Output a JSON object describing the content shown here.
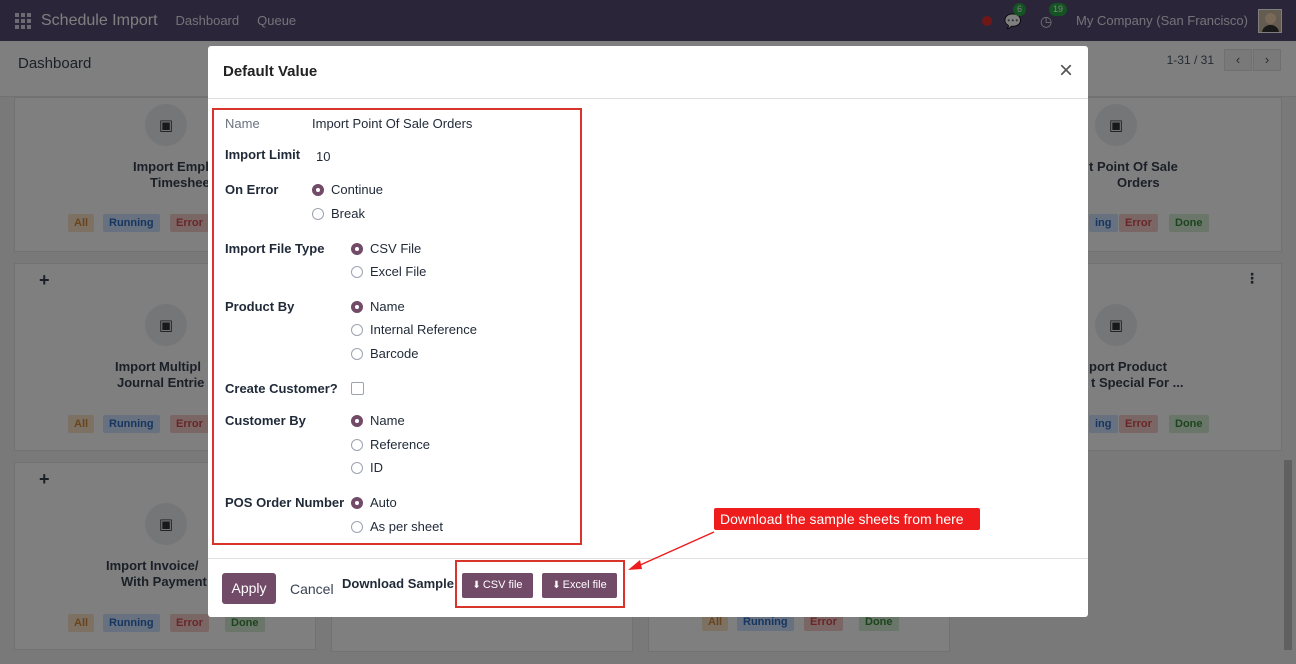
{
  "navbar": {
    "app_title": "Schedule Import",
    "menu": [
      "Dashboard",
      "Queue"
    ],
    "chat_count": "6",
    "activity_count": "19",
    "company": "My Company (San Francisco)"
  },
  "control_panel": {
    "breadcrumb": "Dashboard",
    "pager": "1-31 / 31",
    "prev": "‹",
    "next": "›"
  },
  "cards": {
    "c1": {
      "title": "Import Employee Timesheet",
      "title_visible_left": "Import Employe",
      "title_visible_left2": "Timesheet"
    },
    "c2": {
      "title_visible": "t Point Of Sale",
      "title_visible2": "Orders"
    },
    "c3": {
      "title_visible": "Import Multipl",
      "title_visible2": "Journal Entrie"
    },
    "c4": {
      "title_visible": "port Product",
      "title_visible2": "t Special For ..."
    },
    "c5": {
      "title_visible": "Import Invoice/",
      "title_visible2": "With Payment"
    },
    "plus": "+",
    "tags": {
      "all": "All",
      "running": "Running",
      "error": "Error",
      "done": "Done",
      "running_cut": "ing"
    }
  },
  "modal": {
    "title": "Default Value",
    "close": "×",
    "fields": {
      "name_label": "Name",
      "name_value": "Import Point Of Sale Orders",
      "limit_label": "Import Limit",
      "limit_value": "10",
      "on_error_label": "On Error",
      "on_error_options": [
        "Continue",
        "Break"
      ],
      "file_type_label": "Import File Type",
      "file_type_options": [
        "CSV File",
        "Excel File"
      ],
      "product_by_label": "Product By",
      "product_by_options": [
        "Name",
        "Internal Reference",
        "Barcode"
      ],
      "create_customer_label": "Create Customer?",
      "customer_by_label": "Customer By",
      "customer_by_options": [
        "Name",
        "Reference",
        "ID"
      ],
      "pos_number_label": "POS Order Number",
      "pos_number_options": [
        "Auto",
        "As per sheet"
      ]
    },
    "footer": {
      "apply": "Apply",
      "cancel": "Cancel",
      "download_label": "Download Sample:",
      "csv_btn": "CSV file",
      "excel_btn": "Excel file"
    }
  },
  "annotation": "Download the sample sheets from here",
  "colors": {
    "navbar": "#564a73",
    "primary": "#714b67",
    "highlight": "#d9342b"
  }
}
